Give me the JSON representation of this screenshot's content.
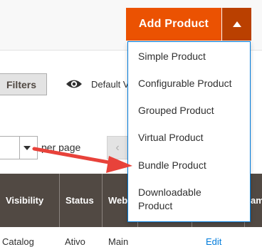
{
  "add_product": {
    "main_label": "Add Product",
    "toggle_icon": "caret-up-icon",
    "options": [
      "Simple Product",
      "Configurable Product",
      "Grouped Product",
      "Virtual Product",
      "Bundle Product",
      "Downloadable Product"
    ]
  },
  "toolbar": {
    "filters_label": "Filters",
    "view_icon": "eye-icon",
    "view_label": "Default V",
    "per_page_label": "per page",
    "prev_icon": "chevron-left-icon"
  },
  "grid": {
    "columns": [
      "Visibility",
      "Status",
      "Webs",
      "",
      "am"
    ],
    "first_row": [
      "Catalog",
      "Ativo",
      "Main",
      "Edit"
    ]
  },
  "colors": {
    "accent": "#eb5202",
    "accent_dark": "#ba4000",
    "header_bg": "#514943",
    "link": "#007bdb",
    "annotation_arrow": "#e8423a"
  }
}
